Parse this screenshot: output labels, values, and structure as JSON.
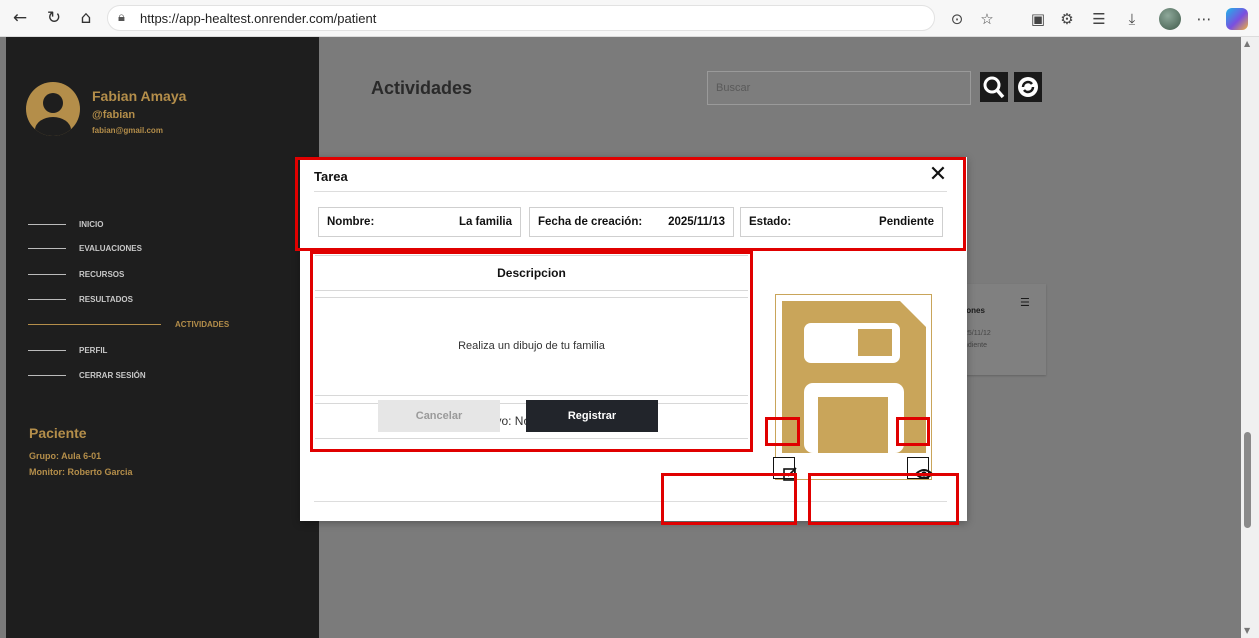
{
  "browser": {
    "url": "https://app-healtest.onrender.com/patient",
    "lock_icon": "lock-icon"
  },
  "sidebar": {
    "user_name": "Fabian Amaya",
    "user_handle": "@fabian",
    "user_email": "fabian@gmail.com",
    "menu": [
      {
        "label": "INICIO"
      },
      {
        "label": "EVALUACIONES"
      },
      {
        "label": "RECURSOS"
      },
      {
        "label": "RESULTADOS"
      },
      {
        "label": "ACTIVIDADES",
        "active": true
      },
      {
        "label": "PERFIL"
      },
      {
        "label": "CERRAR SESIÓN"
      }
    ],
    "role": "Paciente",
    "group": "Grupo: Aula 6-01",
    "monitor": "Monitor: Roberto Garcia"
  },
  "main": {
    "title": "Actividades",
    "search_placeholder": "Buscar",
    "bg_card": {
      "title": "iones",
      "date": "25/11/12",
      "status": "ndiente"
    }
  },
  "modal": {
    "title": "Tarea",
    "fields": [
      {
        "label": "Nombre:",
        "value": "La familia"
      },
      {
        "label": "Fecha de creación:",
        "value": "2025/11/13"
      },
      {
        "label": "Estado:",
        "value": "Pendiente"
      }
    ],
    "description_header": "Descripcion",
    "description_text": "Realiza un dibujo de tu familia",
    "file_text": "Archivo: No hay archivo",
    "cancel_label": "Cancelar",
    "register_label": "Registrar"
  },
  "colors": {
    "accent": "#b48e4a",
    "sidebar_bg": "#1e1e1e",
    "annotation": "#e00000"
  }
}
